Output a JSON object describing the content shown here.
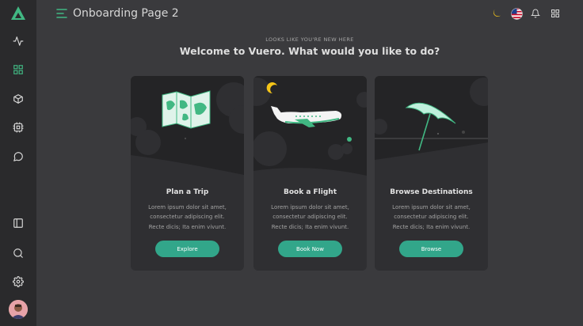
{
  "header": {
    "page_title": "Onboarding Page 2"
  },
  "hero": {
    "subtitle": "LOOKS LIKE YOU'RE NEW HERE",
    "title": "Welcome to Vuero. What would you like to do?"
  },
  "cards": [
    {
      "title": "Plan a Trip",
      "text": "Lorem ipsum dolor sit amet, consectetur adipiscing elit. Recte dicis; Ita enim vivunt.",
      "button": "Explore"
    },
    {
      "title": "Book a Flight",
      "text": "Lorem ipsum dolor sit amet, consectetur adipiscing elit. Recte dicis; Ita enim vivunt.",
      "button": "Book Now"
    },
    {
      "title": "Browse Destinations",
      "text": "Lorem ipsum dolor sit amet, consectetur adipiscing elit. Recte dicis; Ita enim vivunt.",
      "button": "Browse"
    }
  ],
  "sidebar": {
    "icons": [
      "logo-icon",
      "activity-icon",
      "grid-icon",
      "box-icon",
      "cpu-icon",
      "chat-icon",
      "layout-icon",
      "search-icon",
      "settings-icon",
      "avatar"
    ]
  },
  "topbar": {
    "icons": [
      "moon-icon",
      "us-flag-icon",
      "bell-icon",
      "apps-grid-icon"
    ]
  },
  "colors": {
    "accent": "#41b883",
    "button": "#32a68a",
    "moon": "#f5c518",
    "background": "#3a3a3d",
    "sidebar": "#2a2a2c",
    "card": "#2f2f32"
  }
}
